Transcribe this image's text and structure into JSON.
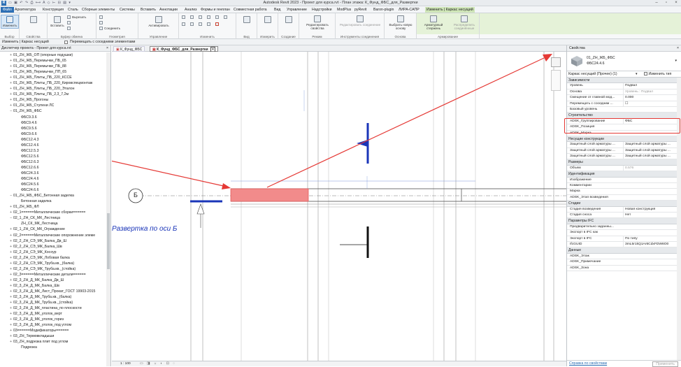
{
  "window": {
    "title": "Autodesk Revit 2023 - Проект для курса.rvt - План этажа: К_Фунд_ФБС_для_Развертки"
  },
  "quick_access": {
    "search_placeholder": ""
  },
  "menu": [
    {
      "label": "Файл"
    },
    {
      "label": "Архитектура"
    },
    {
      "label": "Конструкция"
    },
    {
      "label": "Сталь"
    },
    {
      "label": "Сборные элементы"
    },
    {
      "label": "Системы"
    },
    {
      "label": "Вставить"
    },
    {
      "label": "Аннотации"
    },
    {
      "label": "Анализ"
    },
    {
      "label": "Формы и генплан"
    },
    {
      "label": "Совместная работа"
    },
    {
      "label": "Вид"
    },
    {
      "label": "Управление"
    },
    {
      "label": "Надстройки"
    },
    {
      "label": "ModPlus"
    },
    {
      "label": "pyRevit"
    },
    {
      "label": "Baron-plugin"
    },
    {
      "label": "ЛИРА-САПР"
    },
    {
      "label": "Изменить | Каркас несущий"
    }
  ],
  "ribbon": {
    "modify": "Изменить",
    "select_group": "Выбор",
    "properties_group": "Свойства",
    "clipboard_group": "Буфер обмена",
    "paste": "Вставить",
    "cut": "Вырезать",
    "join": "Соединить",
    "geometry_group": "Геометрия",
    "activate": "Активировать",
    "manage_group": "Управление",
    "modify_group": "Изменить",
    "view_group": "Вид",
    "measure_group": "Измерить",
    "create_group": "Создание",
    "edit_props": "Редактировать свойства",
    "mode_group": "Режим",
    "edit_joint": "Редактировать соединение",
    "tools_group": "Инструменты соединения",
    "pick_new": "Выбрать новую основу",
    "host_group": "Основа",
    "rebar": "Арматурный стержень",
    "distribute": "Распределить соединённые",
    "reinforce_group": "Армирование"
  },
  "options_bar": {
    "context": "Изменить | Каркас несущий",
    "checkbox_label": "Перемещать с соседними элементами"
  },
  "browser": {
    "title": "Диспетчер проекта - Проект для курса.rvt",
    "items": [
      {
        "label": "01_ZH_ЖБ_ОП (опорные подушки)",
        "exp": "+"
      },
      {
        "label": "01_ZH_ЖБ_Перемычки_ПБ_65",
        "exp": "+"
      },
      {
        "label": "01_ZH_ЖБ_Перемычки_ПБ_88",
        "exp": "+"
      },
      {
        "label": "01_ZH_ЖБ_Перемычки_ПП_65",
        "exp": "+"
      },
      {
        "label": "01_ZH_ЖБ_Плиты_ПБ_220_КССЕ",
        "exp": "+"
      },
      {
        "label": "01_ZH_ЖБ_Плиты_ПБ_220_Кировспецмонтаж",
        "exp": "+"
      },
      {
        "label": "01_ZH_ЖБ_Плиты_ПБ_220_Эталон",
        "exp": "+"
      },
      {
        "label": "01_ZH_ЖБ_Плиты_ПБ_2,3_7,2м",
        "exp": "+"
      },
      {
        "label": "01_ZH_ЖБ_Прогоны",
        "exp": "+"
      },
      {
        "label": "01_ZH_ЖБ_Ступени ЛС",
        "exp": "+"
      },
      {
        "label": "01_ZH_ЖБ_ФБС",
        "exp": "−"
      },
      {
        "label": "ФБС9.3.6",
        "exp": "",
        "indent": true
      },
      {
        "label": "ФБС9.4.6",
        "exp": "",
        "indent": true
      },
      {
        "label": "ФБС9.5.6",
        "exp": "",
        "indent": true
      },
      {
        "label": "ФБС9.6.6",
        "exp": "",
        "indent": true
      },
      {
        "label": "ФБС12.4.3",
        "exp": "",
        "indent": true
      },
      {
        "label": "ФБС12.4.6",
        "exp": "",
        "indent": true
      },
      {
        "label": "ФБС12.5.3",
        "exp": "",
        "indent": true
      },
      {
        "label": "ФБС12.5.6",
        "exp": "",
        "indent": true
      },
      {
        "label": "ФБС12.6.3",
        "exp": "",
        "indent": true
      },
      {
        "label": "ФБС12.6.6",
        "exp": "",
        "indent": true
      },
      {
        "label": "ФБС24.3.6",
        "exp": "",
        "indent": true
      },
      {
        "label": "ФБС24.4.6",
        "exp": "",
        "indent": true
      },
      {
        "label": "ФБС24.5.6",
        "exp": "",
        "indent": true
      },
      {
        "label": "ФБС24.6.6",
        "exp": "",
        "indent": true
      },
      {
        "label": "01_ZH_ЖБ_ФБС_Бетонная заделка",
        "exp": "−"
      },
      {
        "label": "Бетонная заделка",
        "exp": "",
        "indent": true
      },
      {
        "label": "01_ZH_ЖБ_ФЛ",
        "exp": "+"
      },
      {
        "label": "02_1======Металлические сборки======",
        "exp": "+"
      },
      {
        "label": "02_1_ZH_СК_МК_Лестница",
        "exp": "−"
      },
      {
        "label": "ZH_СК_МК_Лестница",
        "exp": "",
        "indent": true
      },
      {
        "label": "02_1_ZH_СК_МК_Ограждение",
        "exp": "+"
      },
      {
        "label": "02_2======Металлические опорожнение элеме",
        "exp": "+"
      },
      {
        "label": "02_2_ZH_СЭ_МК_Балка_Дв_Ш",
        "exp": "+"
      },
      {
        "label": "02_2_ZH_СЭ_МК_Балка_Шв",
        "exp": "+"
      },
      {
        "label": "02_2_ZH_СЭ_МК_Косоур",
        "exp": "+"
      },
      {
        "label": "02_2_ZH_СЭ_МК_Лобовая балка",
        "exp": "+"
      },
      {
        "label": "02_2_ZH_СЭ_МК_Труба.кв._(балка)",
        "exp": "+"
      },
      {
        "label": "02_2_ZH_СЭ_МК_Труба.кв._(стойка)",
        "exp": "+"
      },
      {
        "label": "02_3======Металлические детали======",
        "exp": "+"
      },
      {
        "label": "02_3_ZH_Д_МК_Балка_Дв_Ш",
        "exp": "+"
      },
      {
        "label": "02_3_ZH_Д_МК_Балка_Шв",
        "exp": "+"
      },
      {
        "label": "02_3_ZH_Д_МК_Лист_Прокат_ГОСТ 19903-2015",
        "exp": "+"
      },
      {
        "label": "02_3_ZH_Д_МК_Труба.кв._(балка)",
        "exp": "+"
      },
      {
        "label": "02_3_ZH_Д_МК_Труба.кв._(стойка)",
        "exp": "+"
      },
      {
        "label": "02_3_ZH_Д_МК_пластина_по плоскости",
        "exp": "+"
      },
      {
        "label": "02_3_ZH_Д_МК_уголок_верт",
        "exp": "+"
      },
      {
        "label": "02_3_ZH_Д_МК_уголок_гориз",
        "exp": "+"
      },
      {
        "label": "02_3_ZH_Д_МК_уголок_под углом",
        "exp": "+"
      },
      {
        "label": "03======Модификаторы======",
        "exp": "+"
      },
      {
        "label": "03_ZH_Термовкладыши",
        "exp": "+"
      },
      {
        "label": "03_ZH_подрезка плит под углом",
        "exp": "+"
      },
      {
        "label": "Подрезка",
        "exp": "",
        "indent": true
      }
    ]
  },
  "view": {
    "tabs": [
      {
        "label": "К_Фунд_ФБС"
      },
      {
        "label": "К_Фунд_ФБС_для_Развертки"
      }
    ],
    "grid_label": "Б",
    "annotation": "Развертка по оси Б",
    "scale": "1 : 100"
  },
  "properties": {
    "title": "Свойства",
    "family": "01_ZH_ЖБ_ФБС",
    "type": "ФБС24.4.6",
    "selector": "Каркас несущий (Прочее) (1)",
    "edit_type": "Изменить тип",
    "footer_link": "Справка по свойствам",
    "apply": "Применить",
    "rows": [
      {
        "section": "Зависимости"
      },
      {
        "name": "Уровень",
        "value": "Подвал"
      },
      {
        "name": "Основа",
        "value": "Уровень : Подвал",
        "gray": true
      },
      {
        "name": "Смещение от главной мод...",
        "value": "0.000"
      },
      {
        "name": "Перемещать с соседним ...",
        "value": "☐"
      },
      {
        "name": "Базовый уровень",
        "value": ""
      },
      {
        "section": "Строительство"
      },
      {
        "name": "ADSK_Группирование",
        "value": "ФБС"
      },
      {
        "name": "ADSK_Позиция",
        "value": "",
        "gray": true
      },
      {
        "name": "ADSK_Марка",
        "value": ""
      },
      {
        "section": "Несущие конструкции"
      },
      {
        "name": "Защитный слой арматуры ...",
        "value": "Защитный слой арматуры ..."
      },
      {
        "name": "Защитный слой арматуры ...",
        "value": "Защитный слой арматуры ..."
      },
      {
        "name": "Защитный слой арматуры ...",
        "value": "Защитный слой арматуры ..."
      },
      {
        "section": "Размеры"
      },
      {
        "name": "Объем",
        "value": "0.576",
        "gray": true
      },
      {
        "section": "Идентификация"
      },
      {
        "name": "Изображение",
        "value": ""
      },
      {
        "name": "Комментарии",
        "value": ""
      },
      {
        "name": "Марка",
        "value": ""
      },
      {
        "name": "ADSK_Этап возведения",
        "value": ""
      },
      {
        "section": "Стадии"
      },
      {
        "name": "Стадия возведения",
        "value": "Новая конструкция"
      },
      {
        "name": "Стадия сноса",
        "value": "Нет"
      },
      {
        "section": "Параметры IFC"
      },
      {
        "name": "Предварительно заданны...",
        "value": ""
      },
      {
        "name": "Экспорт в IFC как",
        "value": ""
      },
      {
        "name": "Экспорт в IFC",
        "value": "По типу"
      },
      {
        "name": "IfcGUID",
        "value": "3mL5r1kQ1Ar6CdxFDW8O0"
      },
      {
        "section": "Данные"
      },
      {
        "name": "ADSK_Этаж",
        "value": ""
      },
      {
        "name": "ADSK_Примечание",
        "value": ""
      },
      {
        "name": "ADSK_Зона",
        "value": ""
      }
    ]
  },
  "colors": {
    "accent": "#2c6fb5",
    "contextual_tab": "#cfe6b8",
    "highlight": "#e53935",
    "selection_fill": "#f28b8b",
    "element_blue": "#1a35b8"
  }
}
